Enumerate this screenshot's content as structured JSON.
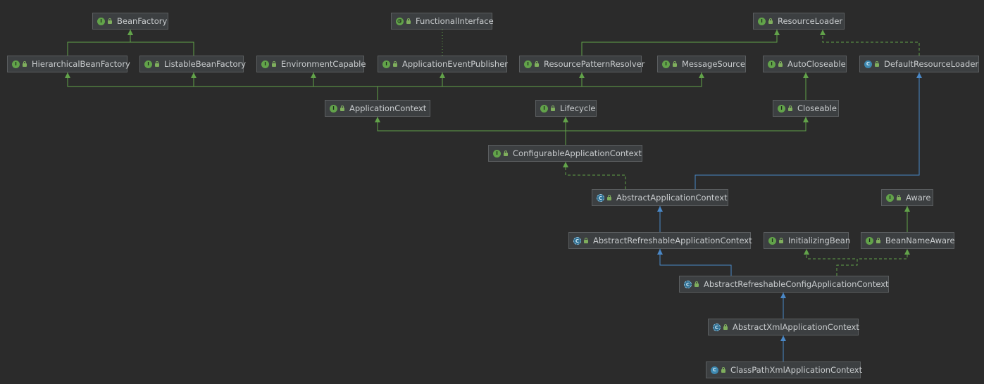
{
  "colors": {
    "background": "#2b2b2b",
    "node_bg": "#3c3f41",
    "interface_arrow": "#62a34a",
    "class_arrow": "#4a88c7"
  },
  "nodes": {
    "BeanFactory": {
      "label": "BeanFactory",
      "kind": "interface"
    },
    "FunctionalInterface": {
      "label": "FunctionalInterface",
      "kind": "annotation"
    },
    "ResourceLoader": {
      "label": "ResourceLoader",
      "kind": "interface"
    },
    "HierarchicalBeanFactory": {
      "label": "HierarchicalBeanFactory",
      "kind": "interface"
    },
    "ListableBeanFactory": {
      "label": "ListableBeanFactory",
      "kind": "interface"
    },
    "EnvironmentCapable": {
      "label": "EnvironmentCapable",
      "kind": "interface"
    },
    "ApplicationEventPublisher": {
      "label": "ApplicationEventPublisher",
      "kind": "interface"
    },
    "ResourcePatternResolver": {
      "label": "ResourcePatternResolver",
      "kind": "interface"
    },
    "MessageSource": {
      "label": "MessageSource",
      "kind": "interface"
    },
    "AutoCloseable": {
      "label": "AutoCloseable",
      "kind": "interface"
    },
    "DefaultResourceLoader": {
      "label": "DefaultResourceLoader",
      "kind": "class"
    },
    "ApplicationContext": {
      "label": "ApplicationContext",
      "kind": "interface"
    },
    "Lifecycle": {
      "label": "Lifecycle",
      "kind": "interface"
    },
    "Closeable": {
      "label": "Closeable",
      "kind": "interface"
    },
    "ConfigurableApplicationContext": {
      "label": "ConfigurableApplicationContext",
      "kind": "interface"
    },
    "AbstractApplicationContext": {
      "label": "AbstractApplicationContext",
      "kind": "abstract"
    },
    "Aware": {
      "label": "Aware",
      "kind": "interface"
    },
    "AbstractRefreshableApplicationContext": {
      "label": "AbstractRefreshableApplicationContext",
      "kind": "abstract"
    },
    "InitializingBean": {
      "label": "InitializingBean",
      "kind": "interface"
    },
    "BeanNameAware": {
      "label": "BeanNameAware",
      "kind": "interface"
    },
    "AbstractRefreshableConfigApplicationContext": {
      "label": "AbstractRefreshableConfigApplicationContext",
      "kind": "abstract"
    },
    "AbstractXmlApplicationContext": {
      "label": "AbstractXmlApplicationContext",
      "kind": "abstract"
    },
    "ClassPathXmlApplicationContext": {
      "label": "ClassPathXmlApplicationContext",
      "kind": "class"
    }
  },
  "edges": [
    {
      "from": "HierarchicalBeanFactory",
      "to": "BeanFactory",
      "type": "extends-interface"
    },
    {
      "from": "ListableBeanFactory",
      "to": "BeanFactory",
      "type": "extends-interface"
    },
    {
      "from": "ApplicationEventPublisher",
      "to": "FunctionalInterface",
      "type": "annotated"
    },
    {
      "from": "ResourcePatternResolver",
      "to": "ResourceLoader",
      "type": "extends-interface"
    },
    {
      "from": "DefaultResourceLoader",
      "to": "ResourceLoader",
      "type": "implements"
    },
    {
      "from": "ApplicationContext",
      "to": "HierarchicalBeanFactory",
      "type": "extends-interface"
    },
    {
      "from": "ApplicationContext",
      "to": "ListableBeanFactory",
      "type": "extends-interface"
    },
    {
      "from": "ApplicationContext",
      "to": "EnvironmentCapable",
      "type": "extends-interface"
    },
    {
      "from": "ApplicationContext",
      "to": "ApplicationEventPublisher",
      "type": "extends-interface"
    },
    {
      "from": "ApplicationContext",
      "to": "ResourcePatternResolver",
      "type": "extends-interface"
    },
    {
      "from": "ApplicationContext",
      "to": "MessageSource",
      "type": "extends-interface"
    },
    {
      "from": "Closeable",
      "to": "AutoCloseable",
      "type": "extends-interface"
    },
    {
      "from": "ConfigurableApplicationContext",
      "to": "ApplicationContext",
      "type": "extends-interface"
    },
    {
      "from": "ConfigurableApplicationContext",
      "to": "Lifecycle",
      "type": "extends-interface"
    },
    {
      "from": "ConfigurableApplicationContext",
      "to": "Closeable",
      "type": "extends-interface"
    },
    {
      "from": "AbstractApplicationContext",
      "to": "ConfigurableApplicationContext",
      "type": "implements"
    },
    {
      "from": "AbstractApplicationContext",
      "to": "DefaultResourceLoader",
      "type": "extends-class"
    },
    {
      "from": "AbstractRefreshableApplicationContext",
      "to": "AbstractApplicationContext",
      "type": "extends-class"
    },
    {
      "from": "BeanNameAware",
      "to": "Aware",
      "type": "extends-interface"
    },
    {
      "from": "AbstractRefreshableConfigApplicationContext",
      "to": "AbstractRefreshableApplicationContext",
      "type": "extends-class"
    },
    {
      "from": "AbstractRefreshableConfigApplicationContext",
      "to": "InitializingBean",
      "type": "implements"
    },
    {
      "from": "AbstractRefreshableConfigApplicationContext",
      "to": "BeanNameAware",
      "type": "implements"
    },
    {
      "from": "AbstractXmlApplicationContext",
      "to": "AbstractRefreshableConfigApplicationContext",
      "type": "extends-class"
    },
    {
      "from": "ClassPathXmlApplicationContext",
      "to": "AbstractXmlApplicationContext",
      "type": "extends-class"
    }
  ]
}
